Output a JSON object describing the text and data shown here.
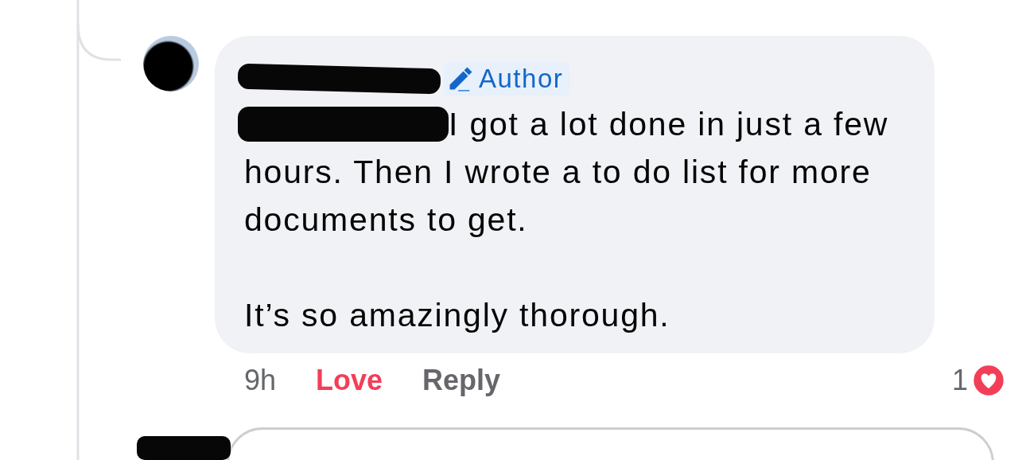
{
  "comment": {
    "author_badge": "Author",
    "first_line": "I got a lot done in just a few",
    "paragraphs": [
      "hours. Then I wrote a to do list for more documents to get.",
      "It’s so amazingly thorough."
    ],
    "time": "9h",
    "actions": [
      {
        "label": "Love",
        "selected": true
      },
      {
        "label": "Reply",
        "selected": false
      }
    ],
    "reaction": {
      "count": "1",
      "kind": "love"
    }
  }
}
